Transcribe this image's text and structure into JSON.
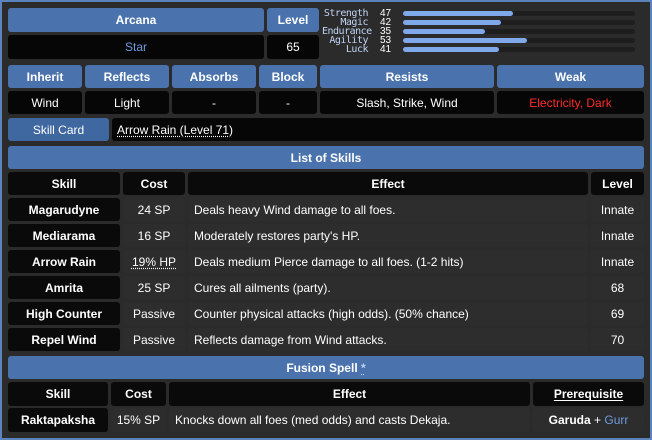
{
  "header": {
    "arcana_label": "Arcana",
    "arcana_value": "Star",
    "level_label": "Level",
    "level_value": "65"
  },
  "stats": [
    {
      "name": "Strength",
      "value": "47",
      "level": 47
    },
    {
      "name": "Magic",
      "value": "42",
      "level": 42
    },
    {
      "name": "Endurance",
      "value": "35",
      "level": 35
    },
    {
      "name": "Agility",
      "value": "53",
      "level": 53
    },
    {
      "name": "Luck",
      "value": "41",
      "level": 41
    }
  ],
  "stats_max": 99,
  "affinities": {
    "headers": [
      "Inherit",
      "Reflects",
      "Absorbs",
      "Block",
      "Resists",
      "Weak"
    ],
    "values": [
      "Wind",
      "Light",
      "-",
      "-",
      "Slash, Strike, Wind",
      "Electricity, Dark"
    ]
  },
  "skill_card": {
    "label": "Skill Card",
    "value": "Arrow Rain (Level 71)"
  },
  "skills": {
    "title": "List of Skills",
    "columns": [
      "Skill",
      "Cost",
      "Effect",
      "Level"
    ],
    "rows": [
      {
        "skill": "Magarudyne",
        "cost": "24 SP",
        "effect": "Deals heavy Wind damage to all foes.",
        "level": "Innate"
      },
      {
        "skill": "Mediarama",
        "cost": "16 SP",
        "effect": "Moderately restores party's HP.",
        "level": "Innate"
      },
      {
        "skill": "Arrow Rain",
        "cost": "19% HP",
        "effect": "Deals medium Pierce damage to all foes. (1-2 hits)",
        "level": "Innate"
      },
      {
        "skill": "Amrita",
        "cost": "25 SP",
        "effect": "Cures all ailments (party).",
        "level": "68"
      },
      {
        "skill": "High Counter",
        "cost": "Passive",
        "effect": "Counter physical attacks (high odds). (50% chance)",
        "level": "69"
      },
      {
        "skill": "Repel Wind",
        "cost": "Passive",
        "effect": "Reflects damage from Wind attacks.",
        "level": "70"
      }
    ]
  },
  "fusion": {
    "title": "Fusion Spell",
    "title_mark": "*",
    "columns": [
      "Skill",
      "Cost",
      "Effect",
      "Prerequisite"
    ],
    "row": {
      "skill": "Raktapaksha",
      "cost": "15% SP",
      "effect": "Knocks down all foes (med odds) and casts Dekaja.",
      "prereq_a": "Garuda",
      "prereq_plus": "+",
      "prereq_b": "Gurr"
    }
  },
  "colors": {
    "header_bg": "#4a73ad",
    "accent_blue": "#6f9be0",
    "weak_red": "#ff2a2a",
    "stat_bar": "#7fa9ea"
  }
}
